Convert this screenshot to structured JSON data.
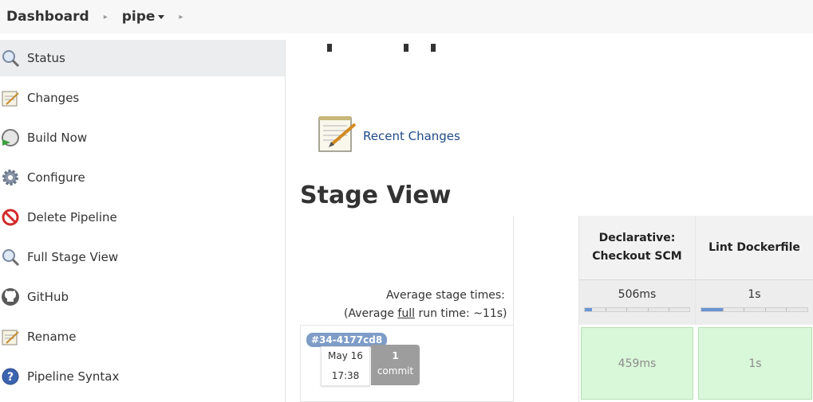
{
  "breadcrumb": {
    "items": [
      {
        "label": "Dashboard"
      },
      {
        "label": "pipe"
      }
    ]
  },
  "sidebar": {
    "items": [
      {
        "label": "Status",
        "icon": "magnifier-icon",
        "active": true
      },
      {
        "label": "Changes",
        "icon": "notepad-icon"
      },
      {
        "label": "Build Now",
        "icon": "clock-play-icon"
      },
      {
        "label": "Configure",
        "icon": "gear-icon"
      },
      {
        "label": "Delete Pipeline",
        "icon": "no-entry-icon"
      },
      {
        "label": "Full Stage View",
        "icon": "magnifier-icon"
      },
      {
        "label": "GitHub",
        "icon": "github-icon"
      },
      {
        "label": "Rename",
        "icon": "notepad-icon"
      },
      {
        "label": "Pipeline Syntax",
        "icon": "help-icon"
      }
    ]
  },
  "main": {
    "recent_changes": "Recent Changes",
    "stage_view_title": "Stage View",
    "avg_stage_times": "Average stage times:",
    "avg_full_prefix": "(Average ",
    "avg_full_underlined": "full",
    "avg_full_suffix": " run time: ~11s)"
  },
  "stages": [
    {
      "name_line1": "Declarative:",
      "name_line2": "Checkout SCM",
      "avg": "506ms",
      "avg_fraction": 0.07,
      "run_time": "459ms"
    },
    {
      "name_line1": "Lint Dockerfile",
      "name_line2": "",
      "avg": "1s",
      "avg_fraction": 0.2,
      "run_time": "1s"
    }
  ],
  "build": {
    "badge": "#34-4177cd8",
    "date": "May 16",
    "time": "17:38",
    "commit_count": "1",
    "commit_word": "commit"
  },
  "colors": {
    "success_cell": "#d9f7d9",
    "badge": "#7e9cc7",
    "link": "#204a87",
    "active_bg": "#ecedef"
  }
}
